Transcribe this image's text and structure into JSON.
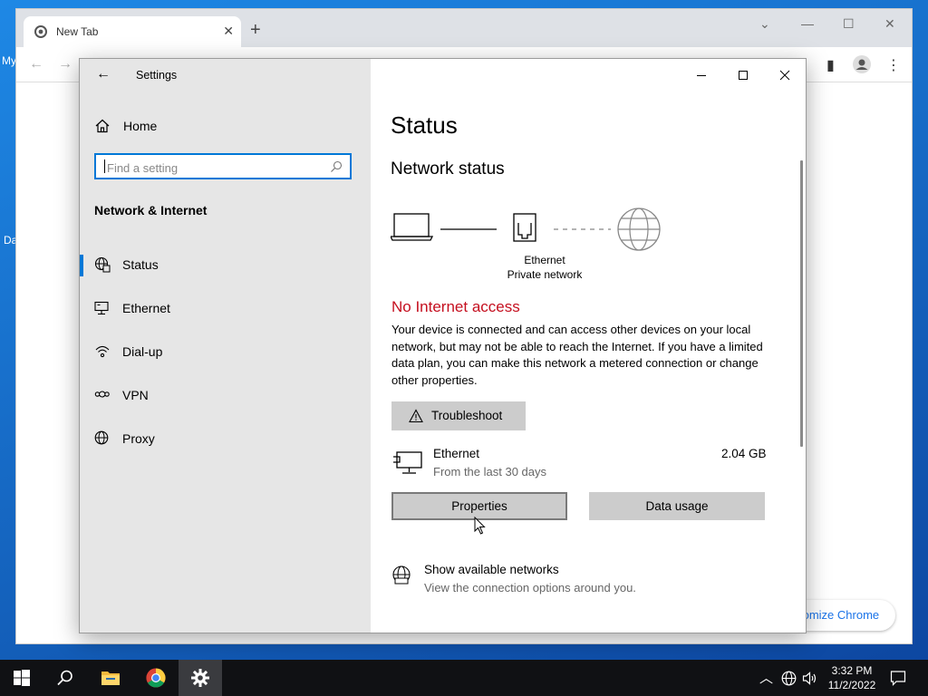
{
  "desktop": {
    "fragments": [
      "My",
      "Da"
    ]
  },
  "chrome": {
    "tab_title": "New Tab",
    "customize_label": "tomize Chrome"
  },
  "settings": {
    "app_title": "Settings",
    "home_label": "Home",
    "search_placeholder": "Find a setting",
    "section_title": "Network & Internet",
    "nav_items": [
      {
        "label": "Status",
        "icon": "status-globe-icon",
        "selected": true
      },
      {
        "label": "Ethernet",
        "icon": "ethernet-icon",
        "selected": false
      },
      {
        "label": "Dial-up",
        "icon": "dial-up-icon",
        "selected": false
      },
      {
        "label": "VPN",
        "icon": "vpn-icon",
        "selected": false
      },
      {
        "label": "Proxy",
        "icon": "proxy-globe-icon",
        "selected": false
      }
    ],
    "main": {
      "page_title": "Status",
      "section_title": "Network status",
      "diagram": {
        "connection_name": "Ethernet",
        "network_type": "Private network"
      },
      "alert_title": "No Internet access",
      "alert_color": "#c50f1f",
      "description": "Your device is connected and can access other devices on your local network, but may not be able to reach the Internet. If you have a limited data plan, you can make this network a metered connection or change other properties.",
      "troubleshoot_label": "Troubleshoot",
      "adapter": {
        "name": "Ethernet",
        "period": "From the last 30 days",
        "usage": "2.04 GB"
      },
      "properties_label": "Properties",
      "data_usage_label": "Data usage",
      "show_networks": {
        "title": "Show available networks",
        "subtitle": "View the connection options around you."
      }
    }
  },
  "taskbar": {
    "time": "3:32 PM",
    "date": "11/2/2022",
    "accent": "#0078d7"
  }
}
